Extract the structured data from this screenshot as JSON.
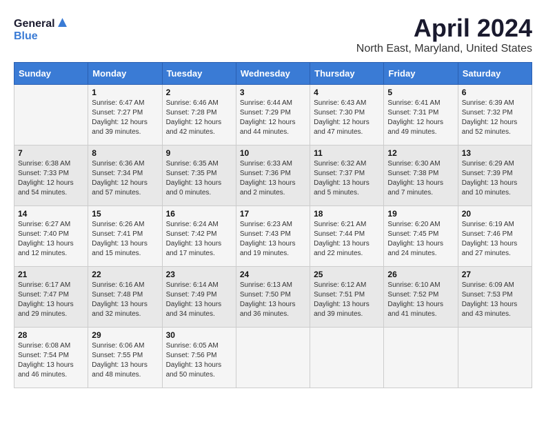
{
  "header": {
    "logo_line1": "General",
    "logo_line2": "Blue",
    "title": "April 2024",
    "subtitle": "North East, Maryland, United States"
  },
  "days_of_week": [
    "Sunday",
    "Monday",
    "Tuesday",
    "Wednesday",
    "Thursday",
    "Friday",
    "Saturday"
  ],
  "weeks": [
    [
      {
        "day": "",
        "sunrise": "",
        "sunset": "",
        "daylight": ""
      },
      {
        "day": "1",
        "sunrise": "Sunrise: 6:47 AM",
        "sunset": "Sunset: 7:27 PM",
        "daylight": "Daylight: 12 hours and 39 minutes."
      },
      {
        "day": "2",
        "sunrise": "Sunrise: 6:46 AM",
        "sunset": "Sunset: 7:28 PM",
        "daylight": "Daylight: 12 hours and 42 minutes."
      },
      {
        "day": "3",
        "sunrise": "Sunrise: 6:44 AM",
        "sunset": "Sunset: 7:29 PM",
        "daylight": "Daylight: 12 hours and 44 minutes."
      },
      {
        "day": "4",
        "sunrise": "Sunrise: 6:43 AM",
        "sunset": "Sunset: 7:30 PM",
        "daylight": "Daylight: 12 hours and 47 minutes."
      },
      {
        "day": "5",
        "sunrise": "Sunrise: 6:41 AM",
        "sunset": "Sunset: 7:31 PM",
        "daylight": "Daylight: 12 hours and 49 minutes."
      },
      {
        "day": "6",
        "sunrise": "Sunrise: 6:39 AM",
        "sunset": "Sunset: 7:32 PM",
        "daylight": "Daylight: 12 hours and 52 minutes."
      }
    ],
    [
      {
        "day": "7",
        "sunrise": "Sunrise: 6:38 AM",
        "sunset": "Sunset: 7:33 PM",
        "daylight": "Daylight: 12 hours and 54 minutes."
      },
      {
        "day": "8",
        "sunrise": "Sunrise: 6:36 AM",
        "sunset": "Sunset: 7:34 PM",
        "daylight": "Daylight: 12 hours and 57 minutes."
      },
      {
        "day": "9",
        "sunrise": "Sunrise: 6:35 AM",
        "sunset": "Sunset: 7:35 PM",
        "daylight": "Daylight: 13 hours and 0 minutes."
      },
      {
        "day": "10",
        "sunrise": "Sunrise: 6:33 AM",
        "sunset": "Sunset: 7:36 PM",
        "daylight": "Daylight: 13 hours and 2 minutes."
      },
      {
        "day": "11",
        "sunrise": "Sunrise: 6:32 AM",
        "sunset": "Sunset: 7:37 PM",
        "daylight": "Daylight: 13 hours and 5 minutes."
      },
      {
        "day": "12",
        "sunrise": "Sunrise: 6:30 AM",
        "sunset": "Sunset: 7:38 PM",
        "daylight": "Daylight: 13 hours and 7 minutes."
      },
      {
        "day": "13",
        "sunrise": "Sunrise: 6:29 AM",
        "sunset": "Sunset: 7:39 PM",
        "daylight": "Daylight: 13 hours and 10 minutes."
      }
    ],
    [
      {
        "day": "14",
        "sunrise": "Sunrise: 6:27 AM",
        "sunset": "Sunset: 7:40 PM",
        "daylight": "Daylight: 13 hours and 12 minutes."
      },
      {
        "day": "15",
        "sunrise": "Sunrise: 6:26 AM",
        "sunset": "Sunset: 7:41 PM",
        "daylight": "Daylight: 13 hours and 15 minutes."
      },
      {
        "day": "16",
        "sunrise": "Sunrise: 6:24 AM",
        "sunset": "Sunset: 7:42 PM",
        "daylight": "Daylight: 13 hours and 17 minutes."
      },
      {
        "day": "17",
        "sunrise": "Sunrise: 6:23 AM",
        "sunset": "Sunset: 7:43 PM",
        "daylight": "Daylight: 13 hours and 19 minutes."
      },
      {
        "day": "18",
        "sunrise": "Sunrise: 6:21 AM",
        "sunset": "Sunset: 7:44 PM",
        "daylight": "Daylight: 13 hours and 22 minutes."
      },
      {
        "day": "19",
        "sunrise": "Sunrise: 6:20 AM",
        "sunset": "Sunset: 7:45 PM",
        "daylight": "Daylight: 13 hours and 24 minutes."
      },
      {
        "day": "20",
        "sunrise": "Sunrise: 6:19 AM",
        "sunset": "Sunset: 7:46 PM",
        "daylight": "Daylight: 13 hours and 27 minutes."
      }
    ],
    [
      {
        "day": "21",
        "sunrise": "Sunrise: 6:17 AM",
        "sunset": "Sunset: 7:47 PM",
        "daylight": "Daylight: 13 hours and 29 minutes."
      },
      {
        "day": "22",
        "sunrise": "Sunrise: 6:16 AM",
        "sunset": "Sunset: 7:48 PM",
        "daylight": "Daylight: 13 hours and 32 minutes."
      },
      {
        "day": "23",
        "sunrise": "Sunrise: 6:14 AM",
        "sunset": "Sunset: 7:49 PM",
        "daylight": "Daylight: 13 hours and 34 minutes."
      },
      {
        "day": "24",
        "sunrise": "Sunrise: 6:13 AM",
        "sunset": "Sunset: 7:50 PM",
        "daylight": "Daylight: 13 hours and 36 minutes."
      },
      {
        "day": "25",
        "sunrise": "Sunrise: 6:12 AM",
        "sunset": "Sunset: 7:51 PM",
        "daylight": "Daylight: 13 hours and 39 minutes."
      },
      {
        "day": "26",
        "sunrise": "Sunrise: 6:10 AM",
        "sunset": "Sunset: 7:52 PM",
        "daylight": "Daylight: 13 hours and 41 minutes."
      },
      {
        "day": "27",
        "sunrise": "Sunrise: 6:09 AM",
        "sunset": "Sunset: 7:53 PM",
        "daylight": "Daylight: 13 hours and 43 minutes."
      }
    ],
    [
      {
        "day": "28",
        "sunrise": "Sunrise: 6:08 AM",
        "sunset": "Sunset: 7:54 PM",
        "daylight": "Daylight: 13 hours and 46 minutes."
      },
      {
        "day": "29",
        "sunrise": "Sunrise: 6:06 AM",
        "sunset": "Sunset: 7:55 PM",
        "daylight": "Daylight: 13 hours and 48 minutes."
      },
      {
        "day": "30",
        "sunrise": "Sunrise: 6:05 AM",
        "sunset": "Sunset: 7:56 PM",
        "daylight": "Daylight: 13 hours and 50 minutes."
      },
      {
        "day": "",
        "sunrise": "",
        "sunset": "",
        "daylight": ""
      },
      {
        "day": "",
        "sunrise": "",
        "sunset": "",
        "daylight": ""
      },
      {
        "day": "",
        "sunrise": "",
        "sunset": "",
        "daylight": ""
      },
      {
        "day": "",
        "sunrise": "",
        "sunset": "",
        "daylight": ""
      }
    ]
  ]
}
